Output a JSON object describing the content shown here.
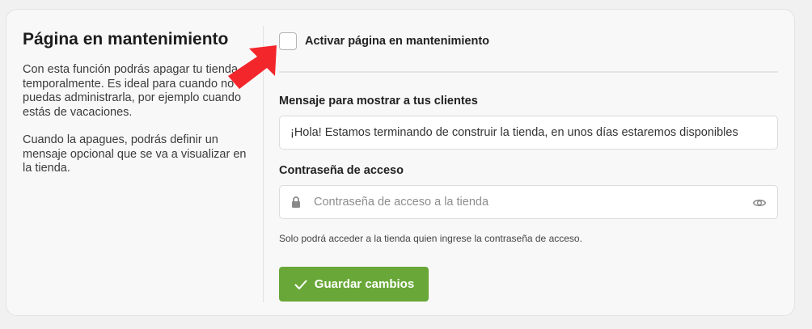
{
  "section": {
    "title": "Página en mantenimiento",
    "description_1": "Con esta función podrás apagar tu tienda temporalmente. Es ideal para cuando no puedas administrarla, por ejemplo cuando estás de vacaciones.",
    "description_2": "Cuando la apagues, podrás definir un mensaje opcional que se va a visualizar en la tienda."
  },
  "maintenance_toggle": {
    "label": "Activar página en mantenimiento",
    "checked": false
  },
  "message_field": {
    "label": "Mensaje para mostrar a tus clientes",
    "value": "¡Hola! Estamos terminando de construir la tienda, en unos días estaremos disponibles"
  },
  "password_field": {
    "label": "Contraseña de acceso",
    "placeholder": "Contraseña de acceso a la tienda",
    "helper": "Solo podrá acceder a la tienda quien ingrese la contraseña de acceso.",
    "icon_left": "lock-icon",
    "icon_right": "eye-icon"
  },
  "save_button": {
    "label": "Guardar cambios",
    "icon": "check-icon",
    "color": "#69a838"
  },
  "annotation": {
    "icon": "arrow-icon",
    "color": "#f3262c"
  }
}
